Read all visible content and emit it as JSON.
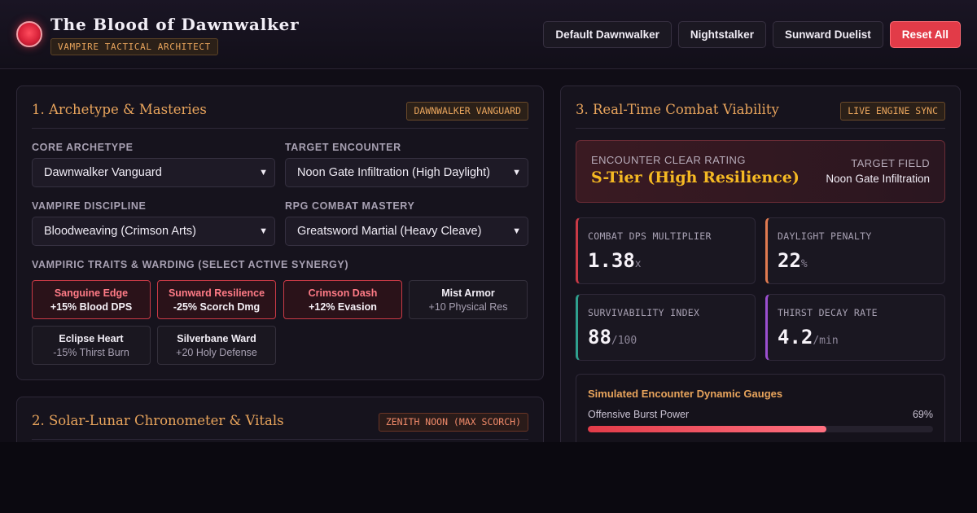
{
  "header": {
    "title": "The Blood of Dawnwalker",
    "badge": "VAMPIRE TACTICAL ARCHITECT",
    "presets": [
      "Default Dawnwalker",
      "Nightstalker",
      "Sunward Duelist"
    ],
    "reset_label": "Reset All",
    "colors": {
      "accent": "#e8a45c",
      "reset": "#e23b48"
    }
  },
  "archetype_panel": {
    "title": "1. Archetype & Masteries",
    "tag": "DAWNWALKER VANGUARD",
    "core_archetype": {
      "label": "CORE ARCHETYPE",
      "value": "Dawnwalker Vanguard"
    },
    "target_encounter": {
      "label": "TARGET ENCOUNTER",
      "value": "Noon Gate Infiltration (High Daylight)"
    },
    "vampire_discipline": {
      "label": "VAMPIRE DISCIPLINE",
      "value": "Bloodweaving (Crimson Arts)"
    },
    "combat_mastery": {
      "label": "RPG COMBAT MASTERY",
      "value": "Greatsword Martial (Heavy Cleave)"
    },
    "traits_label": "VAMPIRIC TRAITS & WARDING (SELECT ACTIVE SYNERGY)",
    "traits": [
      {
        "name": "Sanguine Edge",
        "effect": "+15% Blood DPS",
        "active": true
      },
      {
        "name": "Sunward Resilience",
        "effect": "-25% Scorch Dmg",
        "active": true
      },
      {
        "name": "Crimson Dash",
        "effect": "+12% Evasion",
        "active": true
      },
      {
        "name": "Mist Armor",
        "effect": "+10 Physical Res",
        "active": false
      },
      {
        "name": "Eclipse Heart",
        "effect": "-15% Thirst Burn",
        "active": false
      },
      {
        "name": "Silverbane Ward",
        "effect": "+20 Holy Defense",
        "active": false
      }
    ]
  },
  "chronometer_panel": {
    "title": "2. Solar-Lunar Chronometer & Vitals",
    "tag": "ZENITH NOON (MAX SCORCH)"
  },
  "viability_panel": {
    "title": "3. Real-Time Combat Viability",
    "tag": "LIVE ENGINE SYNC",
    "rating": {
      "label": "ENCOUNTER CLEAR RATING",
      "value": "S-Tier (High Resilience)",
      "target_label": "TARGET FIELD",
      "target_value": "Noon Gate Infiltration"
    },
    "stats": [
      {
        "label": "COMBAT DPS MULTIPLIER",
        "value": "1.38",
        "unit": "x",
        "color": "#c93a46"
      },
      {
        "label": "DAYLIGHT PENALTY",
        "value": "22",
        "unit": "%",
        "color": "#e07a50"
      },
      {
        "label": "SURVIVABILITY INDEX",
        "value": "88",
        "unit": "/100",
        "color": "#2fa08e"
      },
      {
        "label": "THIRST DECAY RATE",
        "value": "4.2",
        "unit": "/min",
        "color": "#9b4fd0"
      }
    ],
    "gauges": {
      "title": "Simulated Encounter Dynamic Gauges",
      "items": [
        {
          "label": "Offensive Burst Power",
          "percent_label": "69%",
          "value": 69
        }
      ]
    }
  }
}
